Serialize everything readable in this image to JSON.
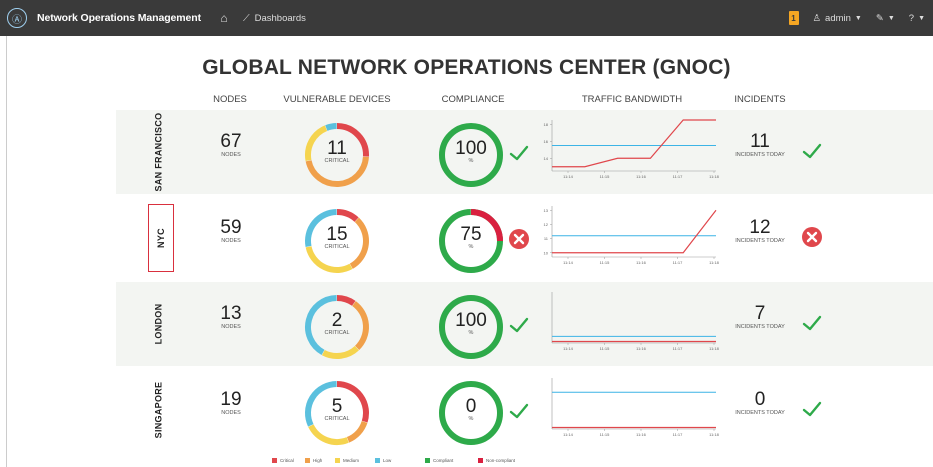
{
  "topbar": {
    "app_title": "Network Operations Management",
    "dashboards_label": "Dashboards",
    "notif_count": "1",
    "user_label": "admin",
    "help_label": "?"
  },
  "title": "GLOBAL NETWORK OPERATIONS CENTER (GNOC)",
  "columns": {
    "nodes": "NODES",
    "vulnerable": "VULNERABLE DEVICES",
    "compliance": "COMPLIANCE",
    "traffic": "TRAFFIC BANDWIDTH",
    "incidents": "INCIDENTS"
  },
  "units": {
    "nodes": "NODES",
    "critical": "CRITICAL",
    "percent": "%",
    "incidents_today": "INCIDENTS TODAY"
  },
  "time_ticks": [
    "11:14",
    "11:15",
    "11:16",
    "11:17",
    "11:18"
  ],
  "colors": {
    "critical": "#e0474c",
    "high": "#f0a04b",
    "medium": "#f5d44f",
    "low": "#5bc0de",
    "compliant": "#2eaa4a",
    "noncompliant": "#d9203f",
    "baseline": "#3cb4e6",
    "traffic": "#e0474c"
  },
  "sites": [
    {
      "city": "SAN FRANCISCO",
      "nodes": "67",
      "vulnerable": "11",
      "vuln_mix": {
        "critical": 0.26,
        "high": 0.46,
        "medium": 0.22,
        "low": 0.06
      },
      "compliance": "100",
      "compliance_fraction": 1.0,
      "compliance_ok": true,
      "incidents": "11",
      "incidents_ok": true,
      "y_ticks": [
        "18",
        "16",
        "14"
      ],
      "y_range": [
        12.5,
        18.5
      ],
      "baseline": 15.5,
      "series": [
        13,
        13,
        14,
        14,
        18.5,
        18.5
      ]
    },
    {
      "city": "NYC",
      "nodes": "59",
      "vulnerable": "15",
      "vuln_mix": {
        "critical": 0.12,
        "high": 0.3,
        "medium": 0.3,
        "low": 0.28
      },
      "compliance": "75",
      "compliance_fraction": 0.75,
      "compliance_ok": false,
      "incidents": "12",
      "incidents_ok": false,
      "y_ticks": [
        "13",
        "12",
        "11",
        "10"
      ],
      "y_range": [
        9.7,
        13.3
      ],
      "baseline": 11.2,
      "series": [
        10,
        10,
        10,
        10,
        10,
        13
      ]
    },
    {
      "city": "LONDON",
      "nodes": "13",
      "vulnerable": "2",
      "vuln_mix": {
        "critical": 0.1,
        "high": 0.28,
        "medium": 0.2,
        "low": 0.42
      },
      "compliance": "100",
      "compliance_fraction": 1.0,
      "compliance_ok": true,
      "incidents": "7",
      "incidents_ok": true,
      "y_ticks": [],
      "y_range": [
        0,
        10
      ],
      "baseline": 1.3,
      "series": [
        0.3,
        0.3,
        0.3,
        0.3,
        0.3,
        0.3
      ]
    },
    {
      "city": "SINGAPORE",
      "nodes": "19",
      "vulnerable": "5",
      "vuln_mix": {
        "critical": 0.3,
        "high": 0.14,
        "medium": 0.24,
        "low": 0.32
      },
      "compliance": "0",
      "compliance_fraction": 1.0,
      "compliance_ok": true,
      "incidents": "0",
      "incidents_ok": true,
      "y_ticks": [],
      "y_range": [
        0,
        10
      ],
      "baseline": 7.2,
      "series": [
        0.3,
        0.3,
        0.3,
        0.3,
        0.3,
        0.3
      ]
    }
  ],
  "legend": {
    "critical": "Critical",
    "high": "High",
    "medium": "Medium",
    "low": "Low",
    "compliant": "Compliant",
    "noncompliant": "Non-compliant"
  }
}
